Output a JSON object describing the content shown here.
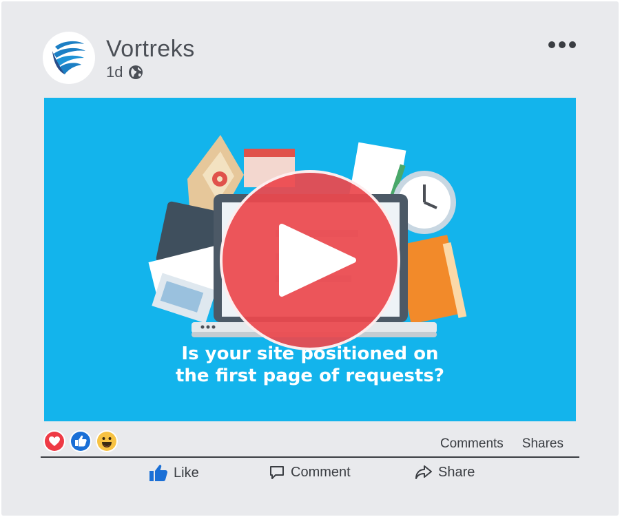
{
  "post": {
    "page_name": "Vortreks",
    "age": "1d",
    "visibility_icon": "globe-icon",
    "more_icon": "more-options-icon"
  },
  "media": {
    "caption_line1": "Is your site positioned on",
    "caption_line2": "the first page of requests?",
    "background": "#13b4ec",
    "play_color": "#ec484e"
  },
  "reactions": {
    "icons": [
      "love-reaction-icon",
      "like-reaction-icon",
      "haha-reaction-icon"
    ],
    "comments_label": "Comments",
    "shares_label": "Shares"
  },
  "actions": {
    "like_label": "Like",
    "comment_label": "Comment",
    "share_label": "Share"
  }
}
